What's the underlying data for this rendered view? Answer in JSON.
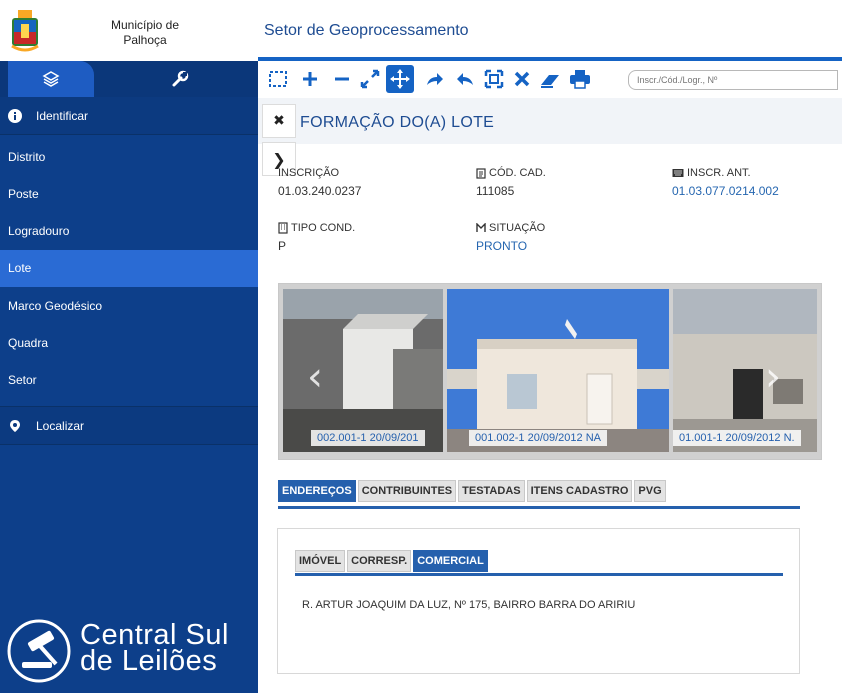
{
  "sidebar": {
    "municipality_line1": "Município de",
    "municipality_line2": "Palhoça",
    "identify_label": "Identificar",
    "items": [
      {
        "label": "Distrito",
        "active": false
      },
      {
        "label": "Poste",
        "active": false
      },
      {
        "label": "Logradouro",
        "active": false
      },
      {
        "label": "Lote",
        "active": true
      },
      {
        "label": "Marco Geodésico",
        "active": false
      },
      {
        "label": "Quadra",
        "active": false
      },
      {
        "label": "Setor",
        "active": false
      }
    ],
    "locate_label": "Localizar",
    "watermark_line1": "Central Sul",
    "watermark_line2": "de Leilões"
  },
  "header": {
    "title": "Setor de Geoprocessamento"
  },
  "toolbar": {
    "icons": [
      "select-box-icon",
      "zoom-in-icon",
      "zoom-out-icon",
      "full-extent-icon",
      "pan-icon",
      "forward-icon",
      "back-icon",
      "zoom-extent-icon",
      "clear-icon",
      "eraser-icon",
      "print-icon"
    ],
    "search_placeholder": "Inscr./Cód./Logr., Nº"
  },
  "panel": {
    "title": "FORMAÇÃO DO(A) LOTE",
    "fields": {
      "inscricao_label": "INSCRIÇÃO",
      "inscricao_value": "01.03.240.0237",
      "cod_cad_label": "CÓD. CAD.",
      "cod_cad_value": "111085",
      "inscr_ant_label": "INSCR. ANT.",
      "inscr_ant_value": "01.03.077.0214.002",
      "tipo_cond_label": "TIPO COND.",
      "tipo_cond_value": "P",
      "situacao_label": "SITUAÇÃO",
      "situacao_value": "PRONTO"
    }
  },
  "carousel": {
    "captions": [
      "002.001-1 20/09/201",
      "001.002-1 20/09/2012 NA",
      "01.001-1 20/09/2012 N."
    ]
  },
  "tabs": [
    "ENDEREÇOS",
    "CONTRIBUINTES",
    "TESTADAS",
    "ITENS CADASTRO",
    "PVG"
  ],
  "active_tab": "ENDEREÇOS",
  "subtabs": [
    "IMÓVEL",
    "CORRESP.",
    "COMERCIAL"
  ],
  "active_subtab": "COMERCIAL",
  "address": "R. ARTUR JOAQUIM DA LUZ, Nº 175, BAIRRO BARRA DO ARIRIU",
  "colors": {
    "sidebar_bg": "#0d3f8a",
    "sidebar_active": "#2a6bd4",
    "accent": "#2560ad",
    "toolbar_blue": "#1563c4"
  }
}
